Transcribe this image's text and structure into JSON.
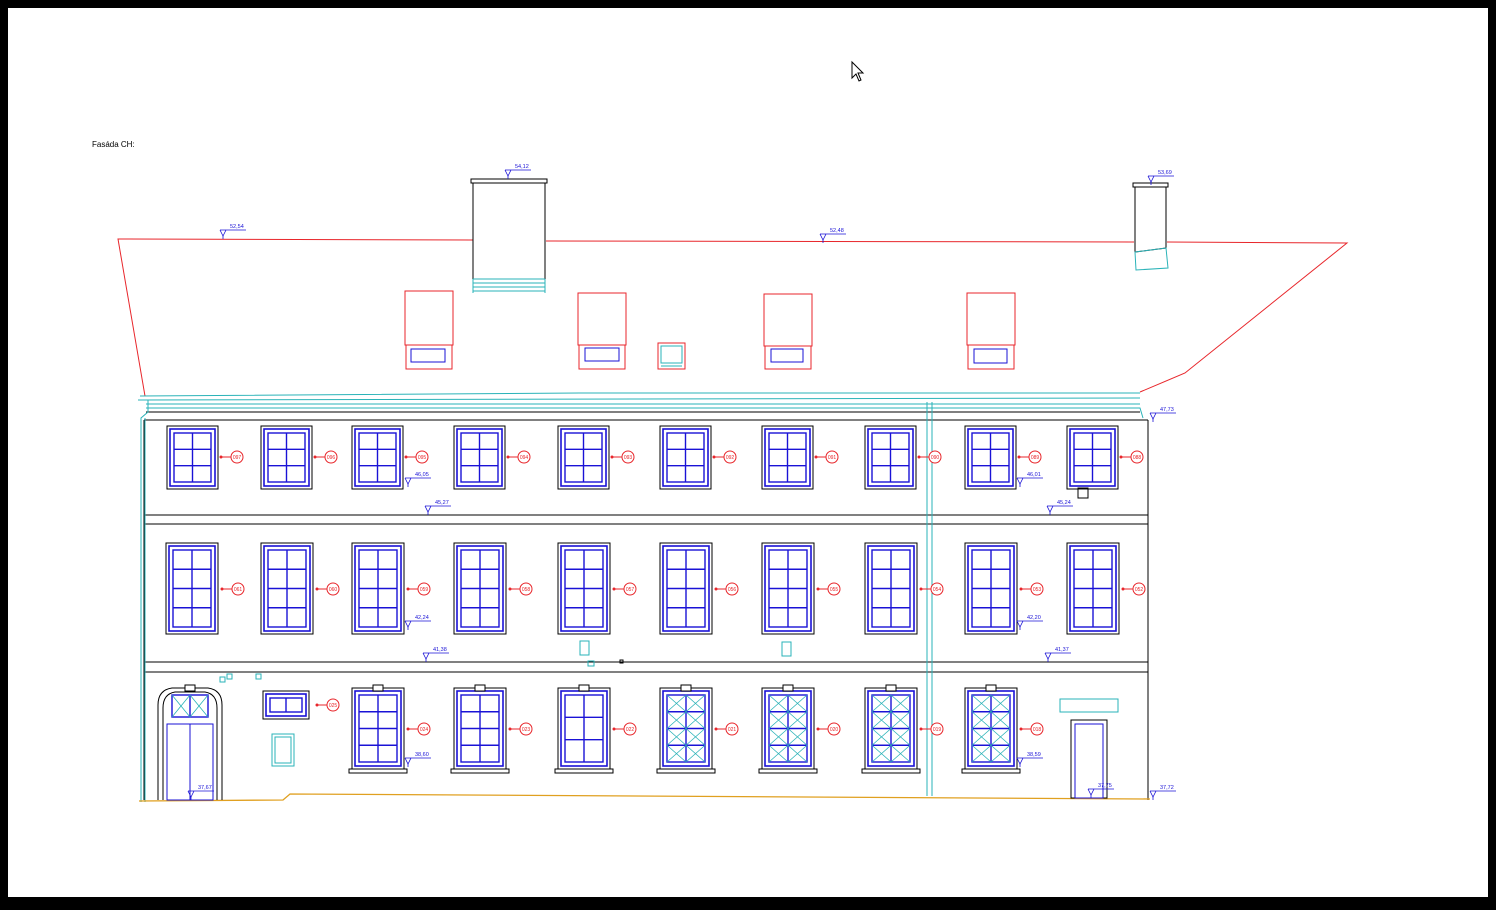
{
  "title": "Fasáda CH:",
  "colors": {
    "frame": "#000000",
    "paper": "#ffffff",
    "roof": "#e8262b",
    "window": "#1a12d6",
    "teal": "#2ab3b8",
    "ground": "#e0a020",
    "dim": "#1a12d6"
  },
  "elevations": {
    "chimney_left": "54,12",
    "chimney_right": "53,69",
    "ridge_left": "52,54",
    "ridge_mid": "52,48",
    "eave_right": "47,73",
    "upper_left": "46,05",
    "upper_right": "46,01",
    "cornice1_left": "45,27",
    "cornice1_right": "45,24",
    "mid_left": "42,24",
    "mid_right": "42,20",
    "cornice2_left": "41,38",
    "cornice2_right": "41,37",
    "low_left": "38,60",
    "low_right": "38,59",
    "ground_door": "37,67",
    "ground_right_door": "37,75",
    "ground_right": "37,72"
  },
  "window_tags": {
    "floor3": [
      "097",
      "096",
      "095",
      "094",
      "093",
      "092",
      "091",
      "090",
      "089",
      "088"
    ],
    "floor2": [
      "061",
      "060",
      "059",
      "058",
      "057",
      "056",
      "055",
      "054",
      "053",
      "052"
    ],
    "floor1": [
      "025",
      "024",
      "023",
      "022",
      "021",
      "020",
      "019",
      "018"
    ]
  },
  "icons": {
    "cursor": "mouse-pointer-icon"
  }
}
